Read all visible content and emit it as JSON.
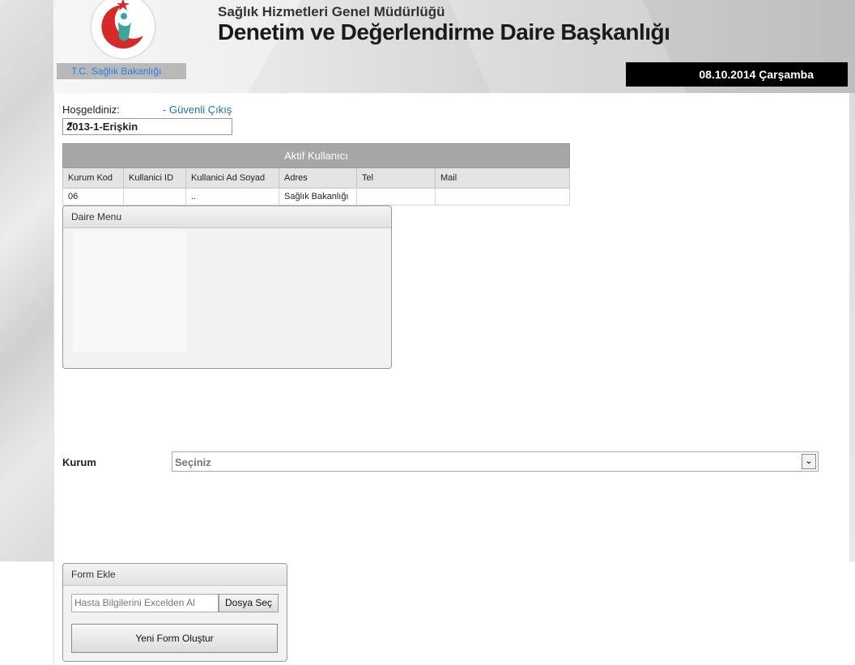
{
  "header": {
    "org": "T.C. Sağlık Bakanlığı",
    "subtitle": "Sağlık Hizmetleri Genel Müdürlüğü",
    "title": "Denetim ve Değerlendirme Daire Başkanlığı",
    "date": "08.10.2014 Çarşamba"
  },
  "welcome": {
    "label": "Hoşgeldiniz:",
    "logout": "- Güvenli Çıkış"
  },
  "season": {
    "selected": "2013-1-Erişkin"
  },
  "active_users": {
    "caption": "Aktif Kullanıcı",
    "columns": [
      "Kurum Kod",
      "Kullanici ID",
      "Kullanici Ad Soyad",
      "Adres",
      "Tel",
      "Mail"
    ],
    "row": [
      "06",
      "",
      "..",
      "Sağlık Bakanlığı",
      "",
      ""
    ]
  },
  "daire_menu": {
    "title": "Daire Menu"
  },
  "kurum": {
    "label": "Kurum",
    "selected": "Seçiniz"
  },
  "form_ekle": {
    "title": "Form Ekle",
    "file_placeholder": "Hasta Bilgilerini Excelden Al",
    "file_button": "Dosya Seç",
    "new_form": "Yeni Form Oluştur"
  },
  "colors": {
    "accent": "#2a7de1",
    "date_bg": "#000000",
    "table_caption": "#a6a6a6"
  }
}
